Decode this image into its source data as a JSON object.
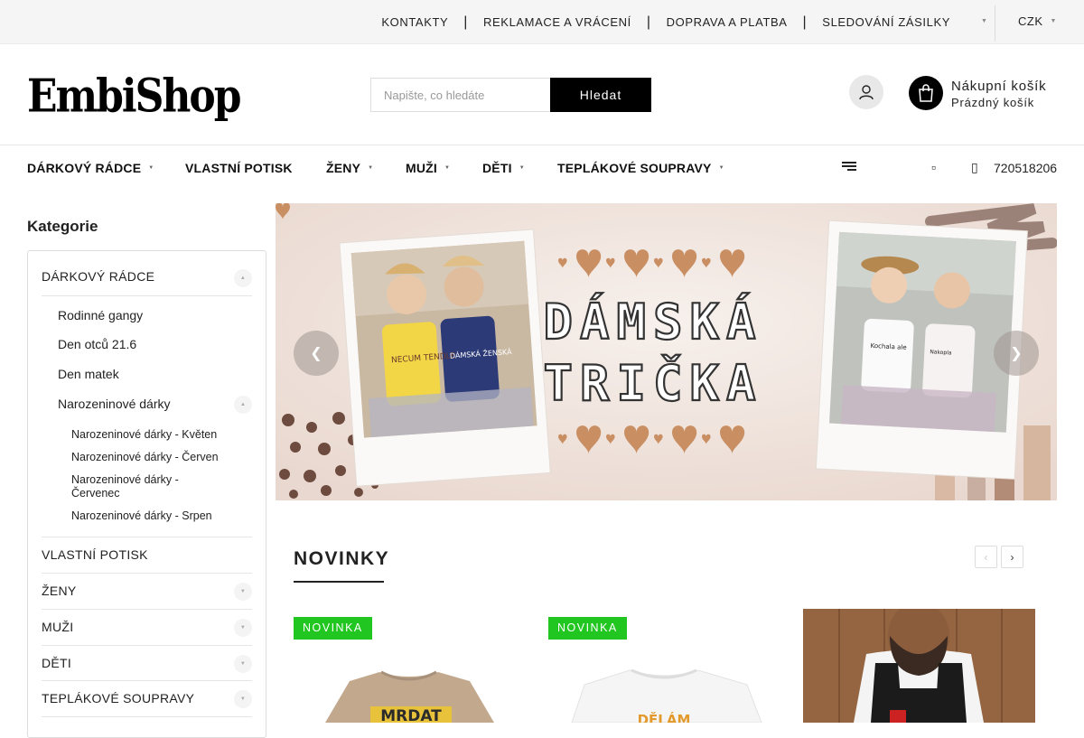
{
  "topbar": {
    "links": [
      "KONTAKTY",
      "REKLAMACE A VRÁCENÍ",
      "DOPRAVA A PLATBA",
      "SLEDOVÁNÍ ZÁSILKY"
    ],
    "currency": "CZK"
  },
  "header": {
    "logo": "EmbiShop",
    "search_placeholder": "Napište, co hledáte",
    "search_button": "Hledat",
    "cart_title": "Nákupní košík",
    "cart_status": "Prázdný košík"
  },
  "nav": {
    "items": [
      "DÁRKOVÝ RÁDCE",
      "VLASTNÍ POTISK",
      "ŽENY",
      "MUŽI",
      "DĚTI",
      "TEPLÁKOVÉ SOUPRAVY"
    ],
    "phone": "720518206"
  },
  "sidebar": {
    "title": "Kategorie",
    "top": "DÁRKOVÝ RÁDCE",
    "sub": [
      "Rodinné gangy",
      "Den otců 21.6",
      "Den matek",
      "Narozeninové dárky"
    ],
    "subsub": [
      "Narozeninové dárky - Květen",
      "Narozeninové dárky - Červen",
      "Narozeninové dárky - Červenec",
      "Narozeninové dárky - Srpen"
    ],
    "rest": [
      "VLASTNÍ POTISK",
      "ŽENY",
      "MUŽI",
      "DĚTI",
      "TEPLÁKOVÉ SOUPRAVY"
    ]
  },
  "banner": {
    "line1": "DÁMSKÁ",
    "line2": "TRIČKA",
    "left_shirt_text": "NECUM TENDLE",
    "left_shirt_text2": "DÁMSKÁ ŽENSKÁ",
    "right_shirt_text": "Kochala ale",
    "right_shirt_text2": "Nakopla"
  },
  "novinky": {
    "title": "NOVINKY",
    "badge": "NOVINKA",
    "card1_print": "MRDAT",
    "card2_print": "DĚLÁM"
  }
}
